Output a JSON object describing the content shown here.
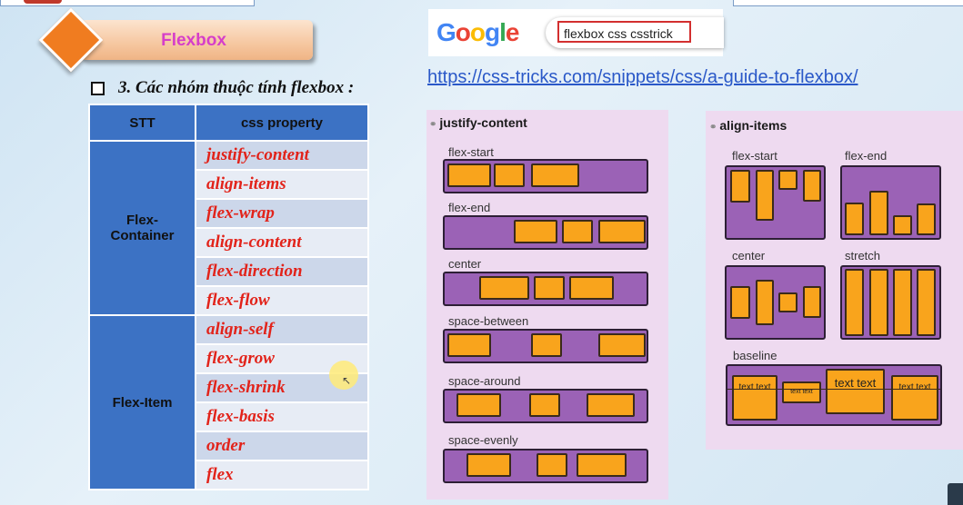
{
  "slide": {
    "title": "Flexbox",
    "heading": "3. Các nhóm thuộc tính flexbox :"
  },
  "table": {
    "headers": [
      "STT",
      "css property"
    ],
    "groups": [
      {
        "name": "Flex-\nContainer",
        "props": [
          "justify-content",
          "align-items",
          "flex-wrap",
          "align-content",
          "flex-direction",
          "flex-flow"
        ]
      },
      {
        "name": "Flex-Item",
        "props": [
          "align-self",
          "flex-grow",
          "flex-shrink",
          "flex-basis",
          "order",
          "flex"
        ]
      }
    ]
  },
  "google": {
    "logo": "Google",
    "search_value": "flexbox css csstrick"
  },
  "link": "https://css-tricks.com/snippets/css/a-guide-to-flexbox/",
  "justify_panel": {
    "title": "justify-content",
    "labels": [
      "flex-start",
      "flex-end",
      "center",
      "space-between",
      "space-around",
      "space-evenly"
    ]
  },
  "align_panel": {
    "title": "align-items",
    "labels": [
      "flex-start",
      "flex-end",
      "center",
      "stretch",
      "baseline"
    ],
    "baseline_texts": [
      "text text",
      "text text",
      "text text",
      "text text"
    ]
  },
  "colors": {
    "accent": "#3c72c4",
    "prop_red": "#e2231a",
    "title_pink": "#d63ec9",
    "box_orange": "#f9a41c",
    "track_purple": "#9b62b6"
  }
}
